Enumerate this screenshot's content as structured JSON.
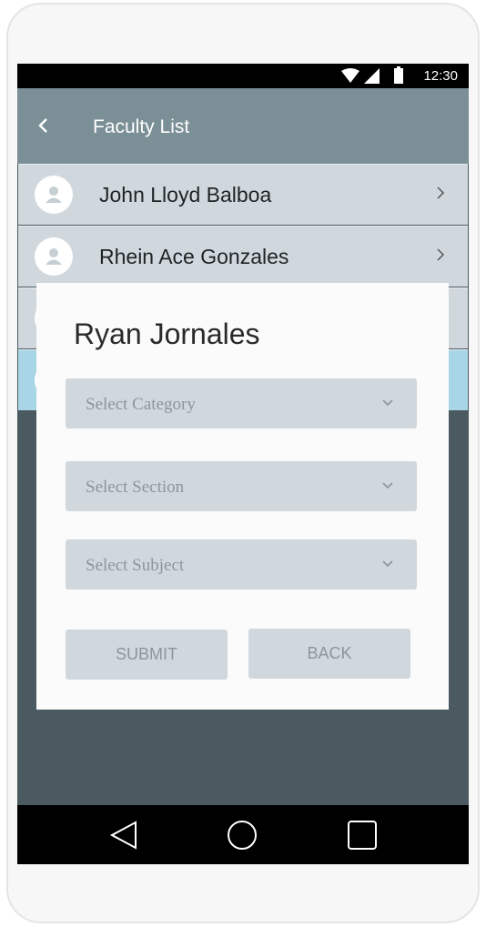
{
  "status_bar": {
    "time": "12:30",
    "icons": [
      "wifi-icon",
      "signal-icon",
      "battery-icon"
    ]
  },
  "app_bar": {
    "title": "Faculty List",
    "back_icon": "chevron-left-icon"
  },
  "faculty_list": [
    {
      "name": "John Lloyd Balboa"
    },
    {
      "name": "Rhein Ace Gonzales"
    }
  ],
  "dialog": {
    "title": "Ryan Jornales",
    "selects": {
      "category": "Select Category",
      "section": "Select Section",
      "subject": "Select Subject"
    },
    "submit_label": "SUBMIT",
    "back_label": "BACK"
  },
  "nav_bar": {
    "icons": [
      "back-triangle-icon",
      "home-circle-icon",
      "recents-square-icon"
    ]
  },
  "colors": {
    "app_bar": "#7b8f96",
    "list_item": "#d0d8de",
    "selected_item": "#a9d6e7",
    "overlay": "#4b5a61"
  }
}
